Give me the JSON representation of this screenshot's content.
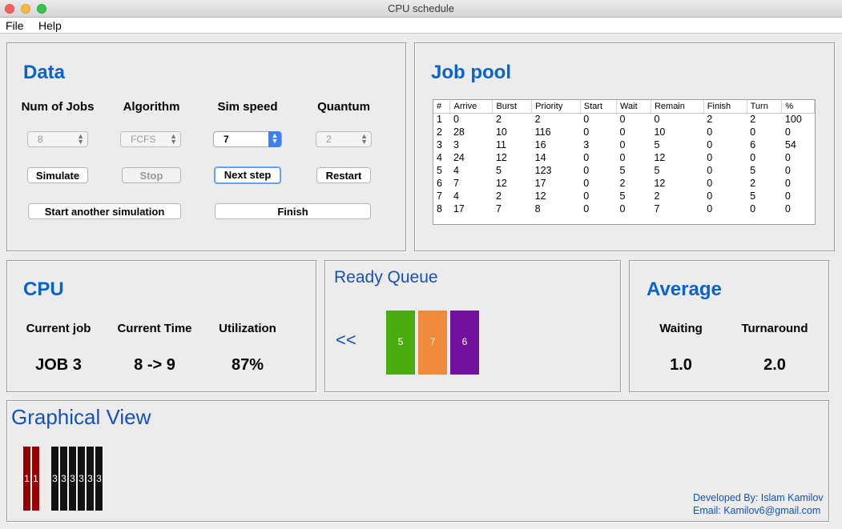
{
  "window": {
    "title": "CPU schedule"
  },
  "menu": [
    "File",
    "Help"
  ],
  "data_panel": {
    "title": "Data",
    "labels": {
      "jobs": "Num of Jobs",
      "algorithm": "Algorithm",
      "speed": "Sim speed",
      "quantum": "Quantum"
    },
    "values": {
      "jobs": "8",
      "algorithm": "FCFS",
      "speed": "7",
      "quantum": "2"
    },
    "buttons": {
      "simulate": "Simulate",
      "stop": "Stop",
      "next": "Next step",
      "restart": "Restart",
      "another": "Start another simulation",
      "finish": "Finish"
    }
  },
  "job_pool": {
    "title": "Job pool",
    "columns": [
      "#",
      "Arrive",
      "Burst",
      "Priority",
      "Start",
      "Wait",
      "Remain",
      "Finish",
      "Turn",
      "%"
    ],
    "rows": [
      [
        "1",
        "0",
        "2",
        "2",
        "0",
        "0",
        "0",
        "2",
        "2",
        "100"
      ],
      [
        "2",
        "28",
        "10",
        "116",
        "0",
        "0",
        "10",
        "0",
        "0",
        "0"
      ],
      [
        "3",
        "3",
        "11",
        "16",
        "3",
        "0",
        "5",
        "0",
        "6",
        "54"
      ],
      [
        "4",
        "24",
        "12",
        "14",
        "0",
        "0",
        "12",
        "0",
        "0",
        "0"
      ],
      [
        "5",
        "4",
        "5",
        "123",
        "0",
        "5",
        "5",
        "0",
        "5",
        "0"
      ],
      [
        "6",
        "7",
        "12",
        "17",
        "0",
        "2",
        "12",
        "0",
        "2",
        "0"
      ],
      [
        "7",
        "4",
        "2",
        "12",
        "0",
        "5",
        "2",
        "0",
        "5",
        "0"
      ],
      [
        "8",
        "17",
        "7",
        "8",
        "0",
        "0",
        "7",
        "0",
        "0",
        "0"
      ]
    ]
  },
  "cpu": {
    "title": "CPU",
    "labels": {
      "job": "Current job",
      "time": "Current Time",
      "util": "Utilization"
    },
    "values": {
      "job": "JOB 3",
      "time": "8 -> 9",
      "util": "87%"
    }
  },
  "ready_queue": {
    "title": "Ready Queue",
    "arrow": "<<",
    "items": [
      {
        "label": "5",
        "color": "#4aac10"
      },
      {
        "label": "7",
        "color": "#f08a3c"
      },
      {
        "label": "6",
        "color": "#72119e"
      }
    ]
  },
  "average": {
    "title": "Average",
    "labels": {
      "waiting": "Waiting",
      "turnaround": "Turnaround"
    },
    "values": {
      "waiting": "1.0",
      "turnaround": "2.0"
    }
  },
  "graphical_view": {
    "title": "Graphical View",
    "bars": [
      {
        "label": "1",
        "color": "#960000"
      },
      {
        "label": "1",
        "color": "#960000"
      },
      {
        "label": "",
        "color": "#ececec"
      },
      {
        "label": "3",
        "color": "#121212"
      },
      {
        "label": "3",
        "color": "#121212"
      },
      {
        "label": "3",
        "color": "#121212"
      },
      {
        "label": "3",
        "color": "#121212"
      },
      {
        "label": "3",
        "color": "#121212"
      },
      {
        "label": "3",
        "color": "#121212"
      }
    ]
  },
  "footer": {
    "developer": "Developed By: Islam Kamilov",
    "email": "Email: Kamilov6@gmail.com"
  }
}
